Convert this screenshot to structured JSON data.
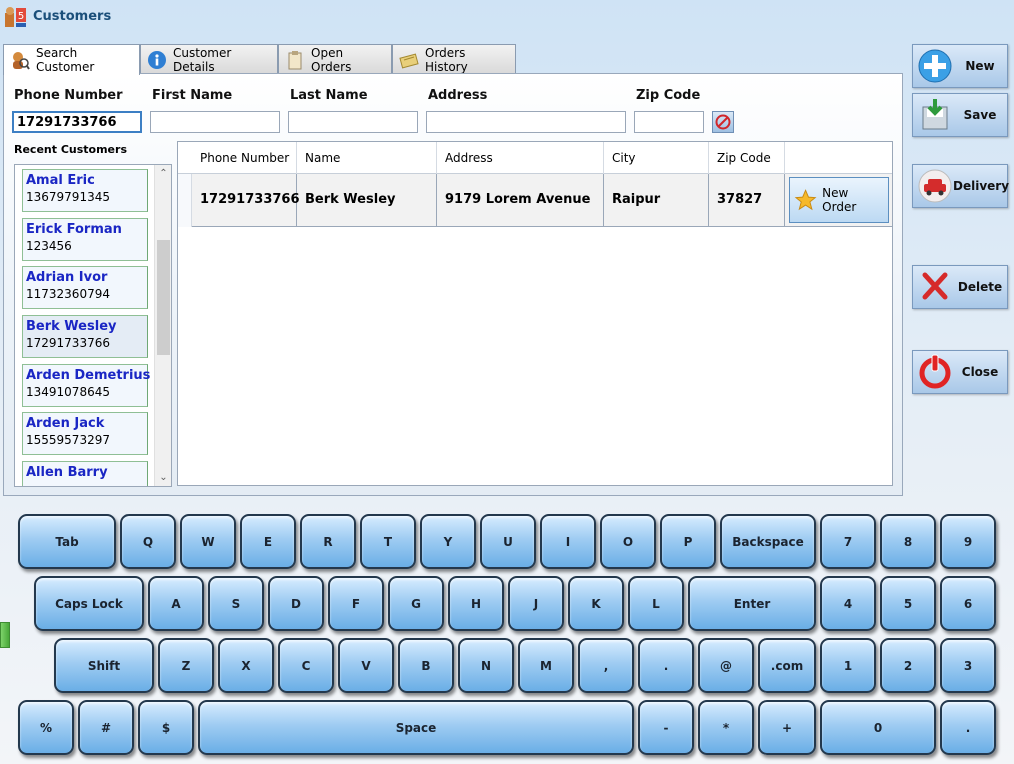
{
  "window": {
    "title": "Customers"
  },
  "tabs": [
    {
      "label": "Search Customer",
      "icon": "search-customer-icon"
    },
    {
      "label": "Customer Details",
      "icon": "info-icon"
    },
    {
      "label": "Open Orders",
      "icon": "clipboard-icon"
    },
    {
      "label": "Orders History",
      "icon": "history-icon"
    }
  ],
  "search": {
    "phone_label": "Phone Number",
    "first_name_label": "First Name",
    "last_name_label": "Last Name",
    "address_label": "Address",
    "zip_label": "Zip Code",
    "phone_value": "17291733766",
    "first_name_value": "",
    "last_name_value": "",
    "address_value": "",
    "zip_value": ""
  },
  "recent": {
    "label": "Recent Customers",
    "items": [
      {
        "name": "Amal Eric",
        "phone": "13679791345"
      },
      {
        "name": "Erick Forman",
        "phone": "123456"
      },
      {
        "name": "Adrian Ivor",
        "phone": "11732360794"
      },
      {
        "name": "Berk Wesley",
        "phone": "17291733766"
      },
      {
        "name": "Arden Demetrius",
        "phone": "13491078645"
      },
      {
        "name": "Arden Jack",
        "phone": "15559573297"
      },
      {
        "name": "Allen Barry",
        "phone": ""
      }
    ]
  },
  "grid": {
    "columns": [
      "Phone Number",
      "Name",
      "Address",
      "City",
      "Zip Code"
    ],
    "rows": [
      {
        "phone": "17291733766",
        "name": "Berk Wesley",
        "address": "9179 Lorem Avenue",
        "city": "Raipur",
        "zip": "37827",
        "action": "New Order"
      }
    ]
  },
  "actions": {
    "new": "New",
    "save": "Save",
    "delivery": "Delivery",
    "delete": "Delete",
    "close": "Close"
  },
  "keyboard": {
    "row1": [
      "Tab",
      "Q",
      "W",
      "E",
      "R",
      "T",
      "Y",
      "U",
      "I",
      "O",
      "P",
      "Backspace",
      "7",
      "8",
      "9"
    ],
    "row2": [
      "Caps Lock",
      "A",
      "S",
      "D",
      "F",
      "G",
      "H",
      "J",
      "K",
      "L",
      "Enter",
      "4",
      "5",
      "6"
    ],
    "row3": [
      "Shift",
      "Z",
      "X",
      "C",
      "V",
      "B",
      "N",
      "M",
      ",",
      ".",
      "@",
      ".com",
      "1",
      "2",
      "3"
    ],
    "row4": [
      "%",
      "#",
      "$",
      "Space",
      "-",
      "*",
      "+",
      "0",
      "."
    ]
  }
}
